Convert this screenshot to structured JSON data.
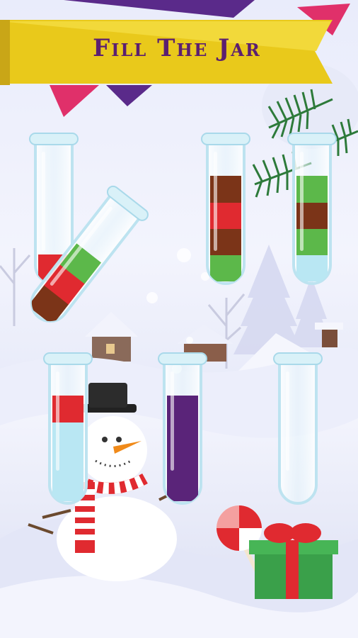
{
  "game": {
    "title": "Fill The Jar",
    "colors": {
      "red": "#e02a30",
      "brown": "#7b3418",
      "green": "#5cb84a",
      "light_blue": "#b9e7f3",
      "purple": "#5a2479"
    },
    "tubes": [
      {
        "id": 1,
        "state": "idle",
        "layers_bottom_to_top": [
          "red"
        ]
      },
      {
        "id": 2,
        "state": "lifted-tilted",
        "layers_bottom_to_top": [
          "brown",
          "red",
          "green"
        ]
      },
      {
        "id": 3,
        "state": "idle",
        "layers_bottom_to_top": [
          "green",
          "brown",
          "red",
          "brown"
        ]
      },
      {
        "id": 4,
        "state": "idle",
        "layers_bottom_to_top": [
          "light_blue",
          "green",
          "brown",
          "green"
        ]
      },
      {
        "id": 5,
        "state": "idle",
        "layers_bottom_to_top": [
          "light_blue",
          "light_blue",
          "light_blue",
          "red"
        ]
      },
      {
        "id": 6,
        "state": "idle",
        "layers_bottom_to_top": [
          "purple",
          "purple",
          "purple",
          "purple"
        ]
      },
      {
        "id": 7,
        "state": "idle",
        "layers_bottom_to_top": []
      }
    ]
  }
}
